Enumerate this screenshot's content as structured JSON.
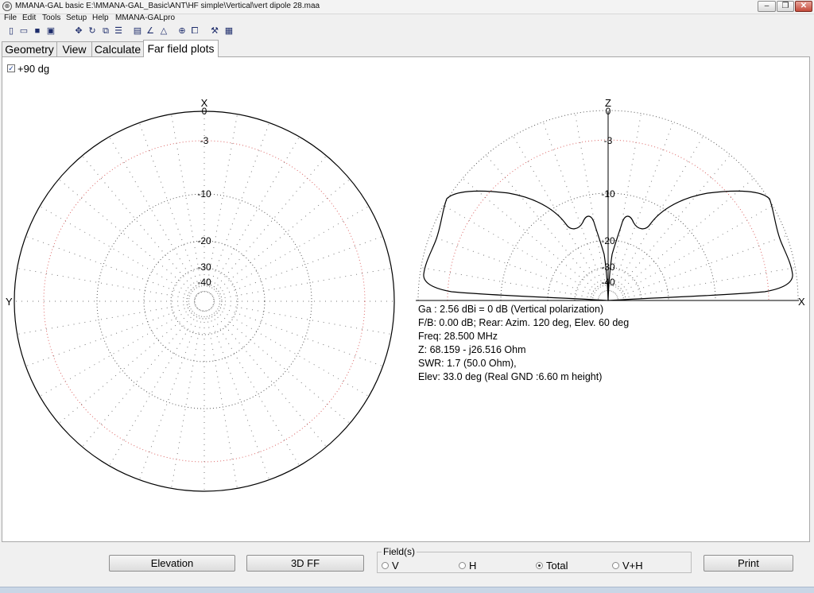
{
  "window": {
    "title": "MMANA-GAL basic  E:\\MMANA-GAL_Basic\\ANT\\HF simple\\Vertical\\vert dipole 28.maa",
    "minimize": "–",
    "restore": "❐",
    "close": "✕"
  },
  "menu": [
    "File",
    "Edit",
    "Tools",
    "Setup",
    "Help",
    "MMANA-GALpro"
  ],
  "toolbar": {
    "icons": [
      "new-icon",
      "open-icon",
      "save-icon",
      "info-icon",
      "move-icon",
      "rotate-icon",
      "zoom-icon",
      "wires-icon",
      "document-icon",
      "chart-icon",
      "triangle-icon",
      "target-icon",
      "copy-icon",
      "tools-icon",
      "calculator-icon"
    ]
  },
  "tabs": [
    "Geometry",
    "View",
    "Calculate",
    "Far field plots"
  ],
  "active_tab": "Far field plots",
  "checkbox": {
    "label": "+90 dg",
    "checked": true
  },
  "plots": {
    "azimuth": {
      "axis_top": "X",
      "axis_left": "Y",
      "rings": [
        "0",
        "-3",
        "-10",
        "-20",
        "-30",
        "-40"
      ]
    },
    "elevation": {
      "axis_top": "Z",
      "axis_right": "X",
      "rings": [
        "0",
        "-3",
        "-10",
        "-20",
        "-30",
        "-40"
      ]
    }
  },
  "info": {
    "ga": "Ga : 2.56 dBi = 0 dB  (Vertical polarization)",
    "fb": "F/B: 0.00 dB; Rear: Azim. 120 deg,  Elev. 60 deg",
    "freq": "Freq: 28.500 MHz",
    "z": "Z: 68.159 - j26.516 Ohm",
    "swr": "SWR: 1.7 (50.0 Ohm),",
    "elev": "Elev: 33.0 deg (Real GND  :6.60 m height)"
  },
  "buttons": {
    "elevation": "Elevation",
    "ff3d": "3D FF",
    "print": "Print"
  },
  "fields": {
    "label": "Field(s)",
    "options": [
      "V",
      "H",
      "Total",
      "V+H"
    ],
    "selected": "Total"
  }
}
